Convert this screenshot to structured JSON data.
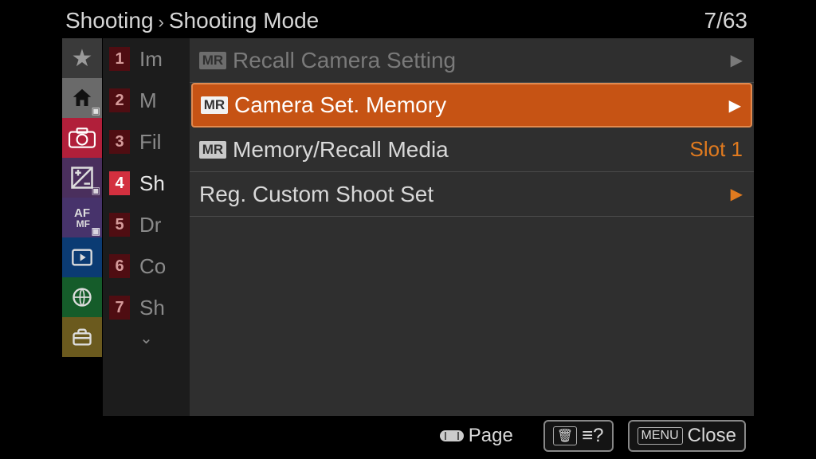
{
  "breadcrumb": {
    "parent": "Shooting",
    "current": "Shooting Mode"
  },
  "page": {
    "index": "7",
    "total": "63"
  },
  "rail": {
    "af_label_top": "AF",
    "af_label_bottom": "MF"
  },
  "numcol": {
    "items": [
      {
        "n": "1",
        "label": "Im"
      },
      {
        "n": "2",
        "label": "M"
      },
      {
        "n": "3",
        "label": "Fil"
      },
      {
        "n": "4",
        "label": "Sh"
      },
      {
        "n": "5",
        "label": "Dr"
      },
      {
        "n": "6",
        "label": "Co"
      },
      {
        "n": "7",
        "label": "Sh"
      }
    ],
    "active_index": 3
  },
  "menu": {
    "items": [
      {
        "badge": "MR",
        "label": "Recall Camera Setting",
        "state": "disabled",
        "arrow": true
      },
      {
        "badge": "MR",
        "label": "Camera Set. Memory",
        "state": "selected",
        "arrow": true
      },
      {
        "badge": "MR",
        "label": "Memory/Recall Media",
        "state": "normal",
        "value": "Slot 1"
      },
      {
        "badge": "",
        "label": "Reg. Custom Shoot Set",
        "state": "normal",
        "arrow": true,
        "arrow_color": "orange"
      }
    ]
  },
  "footer": {
    "page_label": "Page",
    "help_icon": "?",
    "menu_badge": "MENU",
    "close_label": "Close"
  }
}
